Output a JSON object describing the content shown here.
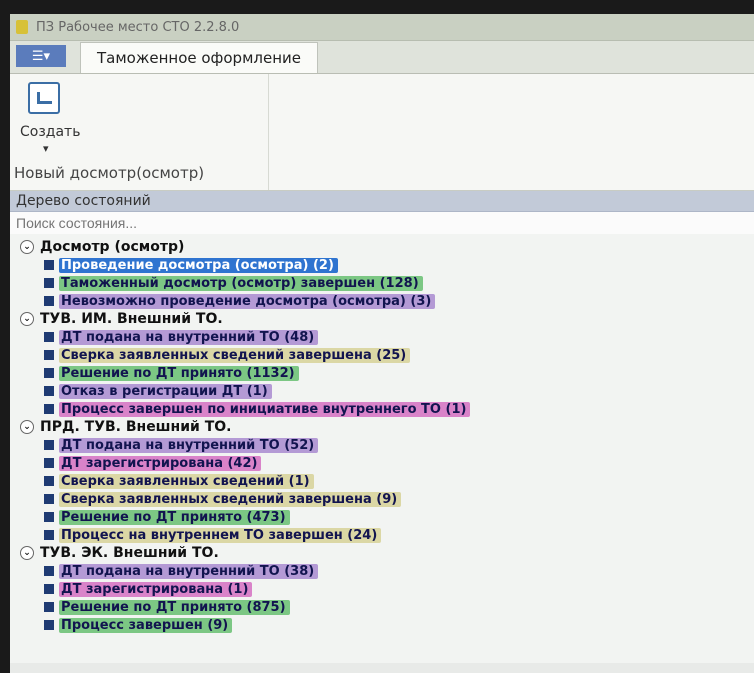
{
  "window": {
    "title": "ПЗ Рабочее место СТО 2.2.8.0"
  },
  "ribbon": {
    "menu_label": "☰▾",
    "tabs": [
      {
        "label": "Таможенное оформление",
        "active": true
      }
    ],
    "groups": [
      {
        "label": "Новый досмотр(осмотр)",
        "button": {
          "label": "Создать",
          "arrow": "▾",
          "icon": "create-document-icon"
        }
      }
    ]
  },
  "panel": {
    "title": "Дерево состояний",
    "search_placeholder": "Поиск состояния..."
  },
  "tree": [
    {
      "label": "Досмотр (осмотр)",
      "toggle_icon": "collapse-icon",
      "children": [
        {
          "label": "Проведение досмотра (осмотра) (2)",
          "color": "#2f74d0",
          "status": "selected"
        },
        {
          "label": "Таможенный досмотр (осмотр) завершен (128)",
          "color": "#7cc784",
          "status": "green"
        },
        {
          "label": "Невозможно проведение досмотра (осмотра) (3)",
          "color": "#b49ad5",
          "status": "purple"
        }
      ]
    },
    {
      "label": "ТУВ. ИМ. Внешний ТО.",
      "toggle_icon": "collapse-icon",
      "children": [
        {
          "label": "ДТ подана на внутренний ТО (48)",
          "color": "#b49ad5",
          "status": "purple"
        },
        {
          "label": "Сверка заявленных сведений завершена (25)",
          "color": "#dbd7a5",
          "status": "yellow"
        },
        {
          "label": "Решение по ДТ принято (1132)",
          "color": "#7cc784",
          "status": "green"
        },
        {
          "label": "Отказ в регистрации ДТ (1)",
          "color": "#b49ad5",
          "status": "purple"
        },
        {
          "label": "Процесс завершен по инициативе внутреннего ТО (1)",
          "color": "#d983c9",
          "status": "pink"
        }
      ]
    },
    {
      "label": "ПРД. ТУВ. Внешний ТО.",
      "toggle_icon": "collapse-icon",
      "children": [
        {
          "label": "ДТ подана на внутренний ТО (52)",
          "color": "#b49ad5",
          "status": "purple"
        },
        {
          "label": "ДТ зарегистрирована (42)",
          "color": "#d983c9",
          "status": "pink"
        },
        {
          "label": "Сверка заявленных сведений (1)",
          "color": "#dbd7a5",
          "status": "yellow"
        },
        {
          "label": "Сверка заявленных сведений завершена (9)",
          "color": "#dbd7a5",
          "status": "yellow"
        },
        {
          "label": "Решение по ДТ принято (473)",
          "color": "#7cc784",
          "status": "green"
        },
        {
          "label": "Процесс на внутреннем ТО завершен (24)",
          "color": "#dbd7a5",
          "status": "yellow"
        }
      ]
    },
    {
      "label": "ТУВ. ЭК. Внешний ТО.",
      "toggle_icon": "collapse-icon",
      "children": [
        {
          "label": "ДТ подана на внутренний ТО (38)",
          "color": "#b49ad5",
          "status": "purple"
        },
        {
          "label": "ДТ зарегистрирована (1)",
          "color": "#d983c9",
          "status": "pink"
        },
        {
          "label": "Решение по ДТ принято (875)",
          "color": "#7cc784",
          "status": "green"
        },
        {
          "label": "Процесс завершен (9)",
          "color": "#7cc784",
          "status": "green"
        }
      ]
    }
  ]
}
